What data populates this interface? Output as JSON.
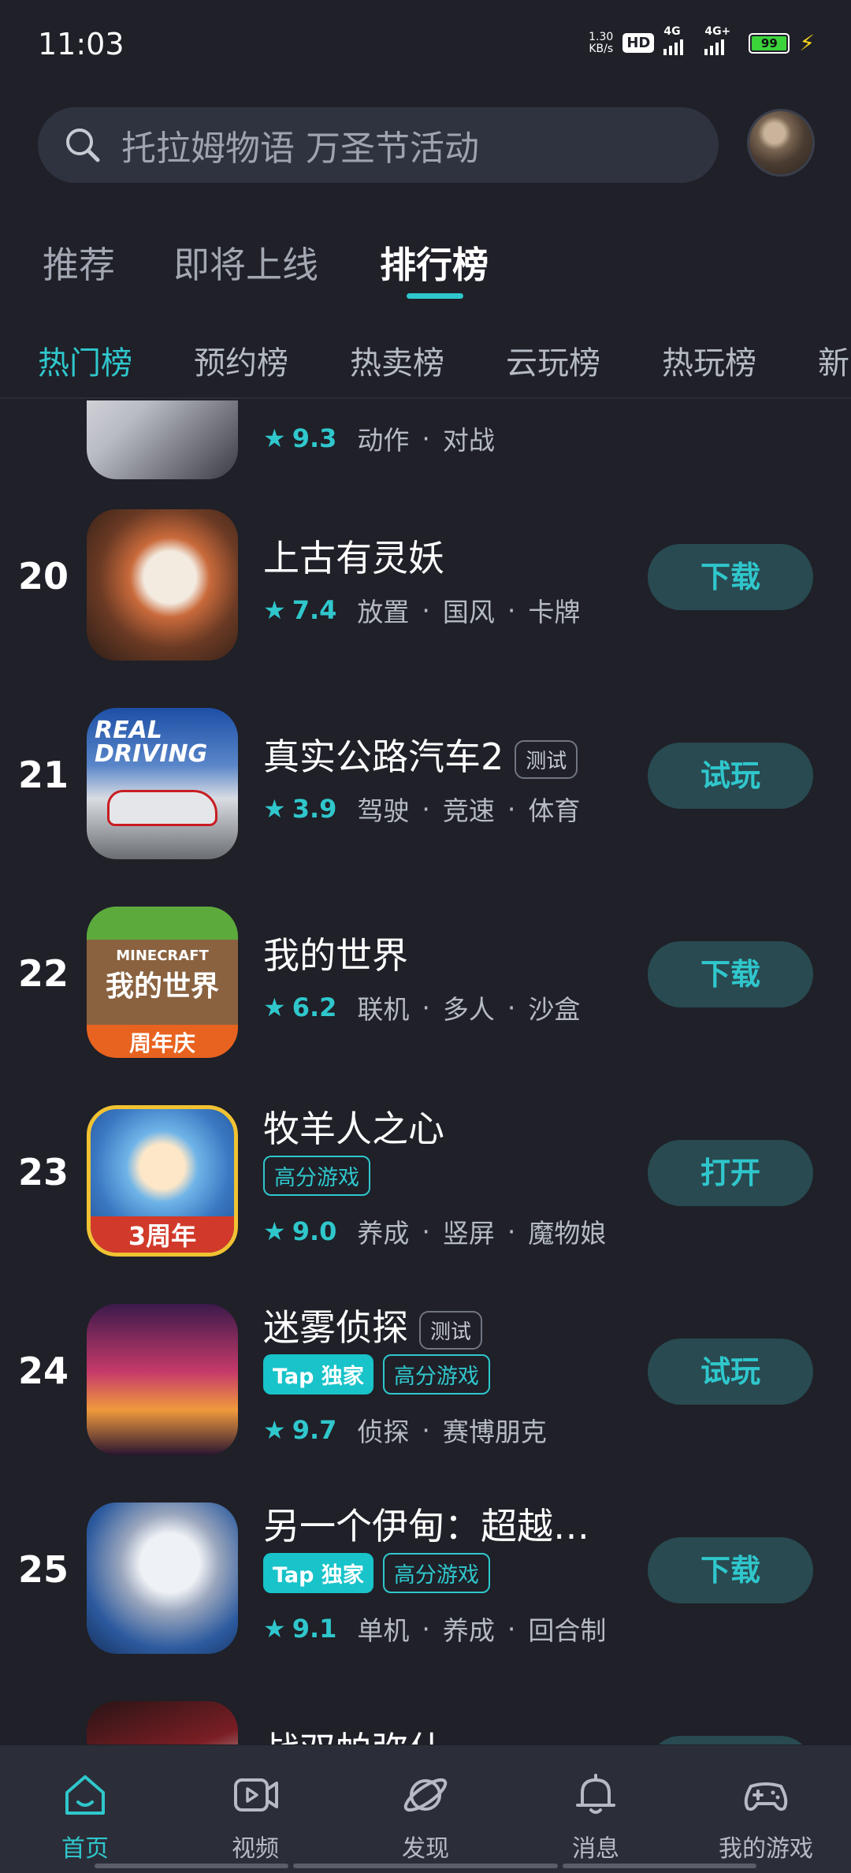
{
  "status_bar": {
    "time": "11:03",
    "net_speed_value": "1.30",
    "net_speed_unit": "KB/s",
    "hd_label": "HD",
    "signal1_label": "4G",
    "signal2_label": "4G+",
    "battery_level": "99"
  },
  "search": {
    "placeholder": "托拉姆物语 万圣节活动"
  },
  "top_tabs": [
    {
      "label": "推荐"
    },
    {
      "label": "即将上线"
    },
    {
      "label": "排行榜"
    }
  ],
  "sub_tabs": [
    {
      "label": "热门榜"
    },
    {
      "label": "预约榜"
    },
    {
      "label": "热卖榜"
    },
    {
      "label": "云玩榜"
    },
    {
      "label": "热玩榜"
    },
    {
      "label": "新"
    }
  ],
  "partial_top_row": {
    "score": "9.3",
    "genres": [
      "动作",
      "对战"
    ]
  },
  "games": [
    {
      "rank": "20",
      "name": "上古有灵妖",
      "score": "7.4",
      "genres": [
        "放置",
        "国风",
        "卡牌"
      ],
      "action": "下载"
    },
    {
      "rank": "21",
      "name": "真实公路汽车2",
      "test_tag": "测试",
      "score": "3.9",
      "genres": [
        "驾驶",
        "竞速",
        "体育"
      ],
      "action": "试玩",
      "icon_text": "REAL DRIVING"
    },
    {
      "rank": "22",
      "name": "我的世界",
      "score": "6.2",
      "genres": [
        "联机",
        "多人",
        "沙盒"
      ],
      "action": "下载",
      "icon_text_top": "MINECRAFT",
      "icon_text_mid": "我的世界",
      "icon_text_bottom": "周年庆"
    },
    {
      "rank": "23",
      "name": "牧羊人之心",
      "tag_high": "高分游戏",
      "score": "9.0",
      "genres": [
        "养成",
        "竖屏",
        "魔物娘"
      ],
      "action": "打开",
      "icon_text": "3周年"
    },
    {
      "rank": "24",
      "name": "迷雾侦探",
      "test_tag": "测试",
      "tag_tap": "Tap 独家",
      "tag_high": "高分游戏",
      "score": "9.7",
      "genres": [
        "侦探",
        "赛博朋克"
      ],
      "action": "试玩"
    },
    {
      "rank": "25",
      "name": "另一个伊甸：超越…",
      "tag_tap": "Tap 独家",
      "tag_high": "高分游戏",
      "score": "9.1",
      "genres": [
        "单机",
        "养成",
        "回合制"
      ],
      "action": "下载"
    }
  ],
  "partial_bottom_row": {
    "name": "战双帕弥什"
  },
  "bottom_nav": [
    {
      "label": "首页",
      "icon": "home-icon"
    },
    {
      "label": "视频",
      "icon": "video-icon"
    },
    {
      "label": "发现",
      "icon": "planet-icon"
    },
    {
      "label": "消息",
      "icon": "bell-icon"
    },
    {
      "label": "我的游戏",
      "icon": "gamepad-icon"
    }
  ],
  "colors": {
    "background": "#1f2028",
    "accent": "#2fc7cc",
    "button_bg": "#284a50",
    "nav_bg": "#2b2e38"
  }
}
